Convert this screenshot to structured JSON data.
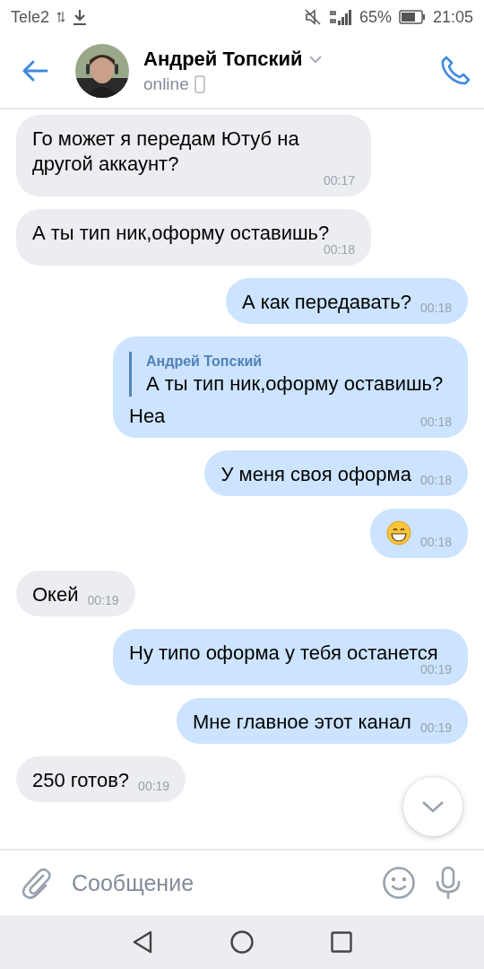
{
  "status_bar": {
    "carrier": "Tele2",
    "battery": "65%",
    "time": "21:05"
  },
  "header": {
    "name": "Андрей Топский",
    "status": "online"
  },
  "messages": [
    {
      "outgoing": false,
      "kind": "text",
      "text": "Го может я передам Ютуб на другой аккаунт?",
      "time": "00:17"
    },
    {
      "outgoing": false,
      "kind": "text",
      "text": "А ты тип ник,оформу оставишь?",
      "time": "00:18"
    },
    {
      "outgoing": true,
      "kind": "text",
      "text": "А как передавать?",
      "time": "00:18"
    },
    {
      "outgoing": true,
      "kind": "reply",
      "reply_author": "Андрей Топский",
      "reply_text": "А ты тип ник,оформу оставишь?",
      "text": "Неа",
      "time": "00:18"
    },
    {
      "outgoing": true,
      "kind": "text",
      "text": "У меня своя оформа",
      "time": "00:18"
    },
    {
      "outgoing": true,
      "kind": "emoji",
      "time": "00:18"
    },
    {
      "outgoing": false,
      "kind": "text",
      "text": "Окей",
      "time": "00:19"
    },
    {
      "outgoing": true,
      "kind": "text",
      "text": "Ну типо оформа у тебя останется",
      "time": "00:19"
    },
    {
      "outgoing": true,
      "kind": "text",
      "text": "Мне главное этот канал",
      "time": "00:19"
    },
    {
      "outgoing": false,
      "kind": "text",
      "text": "250 готов?",
      "time": "00:19"
    }
  ],
  "composer": {
    "placeholder": "Сообщение"
  }
}
